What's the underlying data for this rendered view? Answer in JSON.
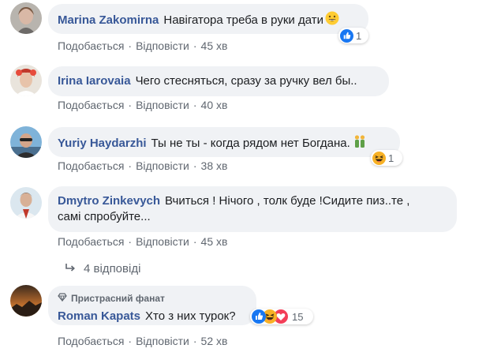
{
  "comments": [
    {
      "author": "Marina Zakomirna",
      "text": "Навігатора треба в руки дати",
      "text_suffix_icon": "grin-emoji-icon",
      "reaction_count": "1",
      "reaction_icons": [
        "like-icon"
      ],
      "actions": {
        "like": "Подобається",
        "reply": "Відповісти",
        "time": "45 хв"
      }
    },
    {
      "author": "Irina Iarovaia",
      "text": "Чего стесняться, сразу за ручку вел бы..",
      "actions": {
        "like": "Подобається",
        "reply": "Відповісти",
        "time": "40 хв"
      }
    },
    {
      "author": "Yuriy Haydarzhi",
      "text": "Ты не ты - когда рядом нет Богдана.",
      "text_suffix_icon": "couple-emoji-icon",
      "reaction_count": "1",
      "reaction_icons": [
        "haha-icon"
      ],
      "actions": {
        "like": "Подобається",
        "reply": "Відповісти",
        "time": "38 хв"
      }
    },
    {
      "author": "Dmytro Zinkevych",
      "text_line1": "Вчиться ! Нічого , толк буде !Сидите пиз..те ,",
      "text_line2": "самі спробуйте...",
      "actions": {
        "like": "Подобається",
        "reply": "Відповісти",
        "time": "45 хв"
      },
      "replies": "4 відповіді",
      "replies_icon": "reply-arrow-icon"
    },
    {
      "badge": "Пристрасний фанат",
      "badge_icon": "diamond-icon",
      "author": "Roman Kapats",
      "text": "Хто з них турок?",
      "reaction_count": "15",
      "reaction_icons": [
        "like-icon",
        "haha-icon",
        "love-icon"
      ],
      "actions": {
        "like": "Подобається",
        "reply": "Відповісти",
        "time": "52 хв"
      }
    }
  ],
  "colors": {
    "author": "#385898",
    "bubble": "#f0f2f5",
    "meta": "#606770",
    "like": "#1877f2",
    "love": "#f33e58"
  }
}
